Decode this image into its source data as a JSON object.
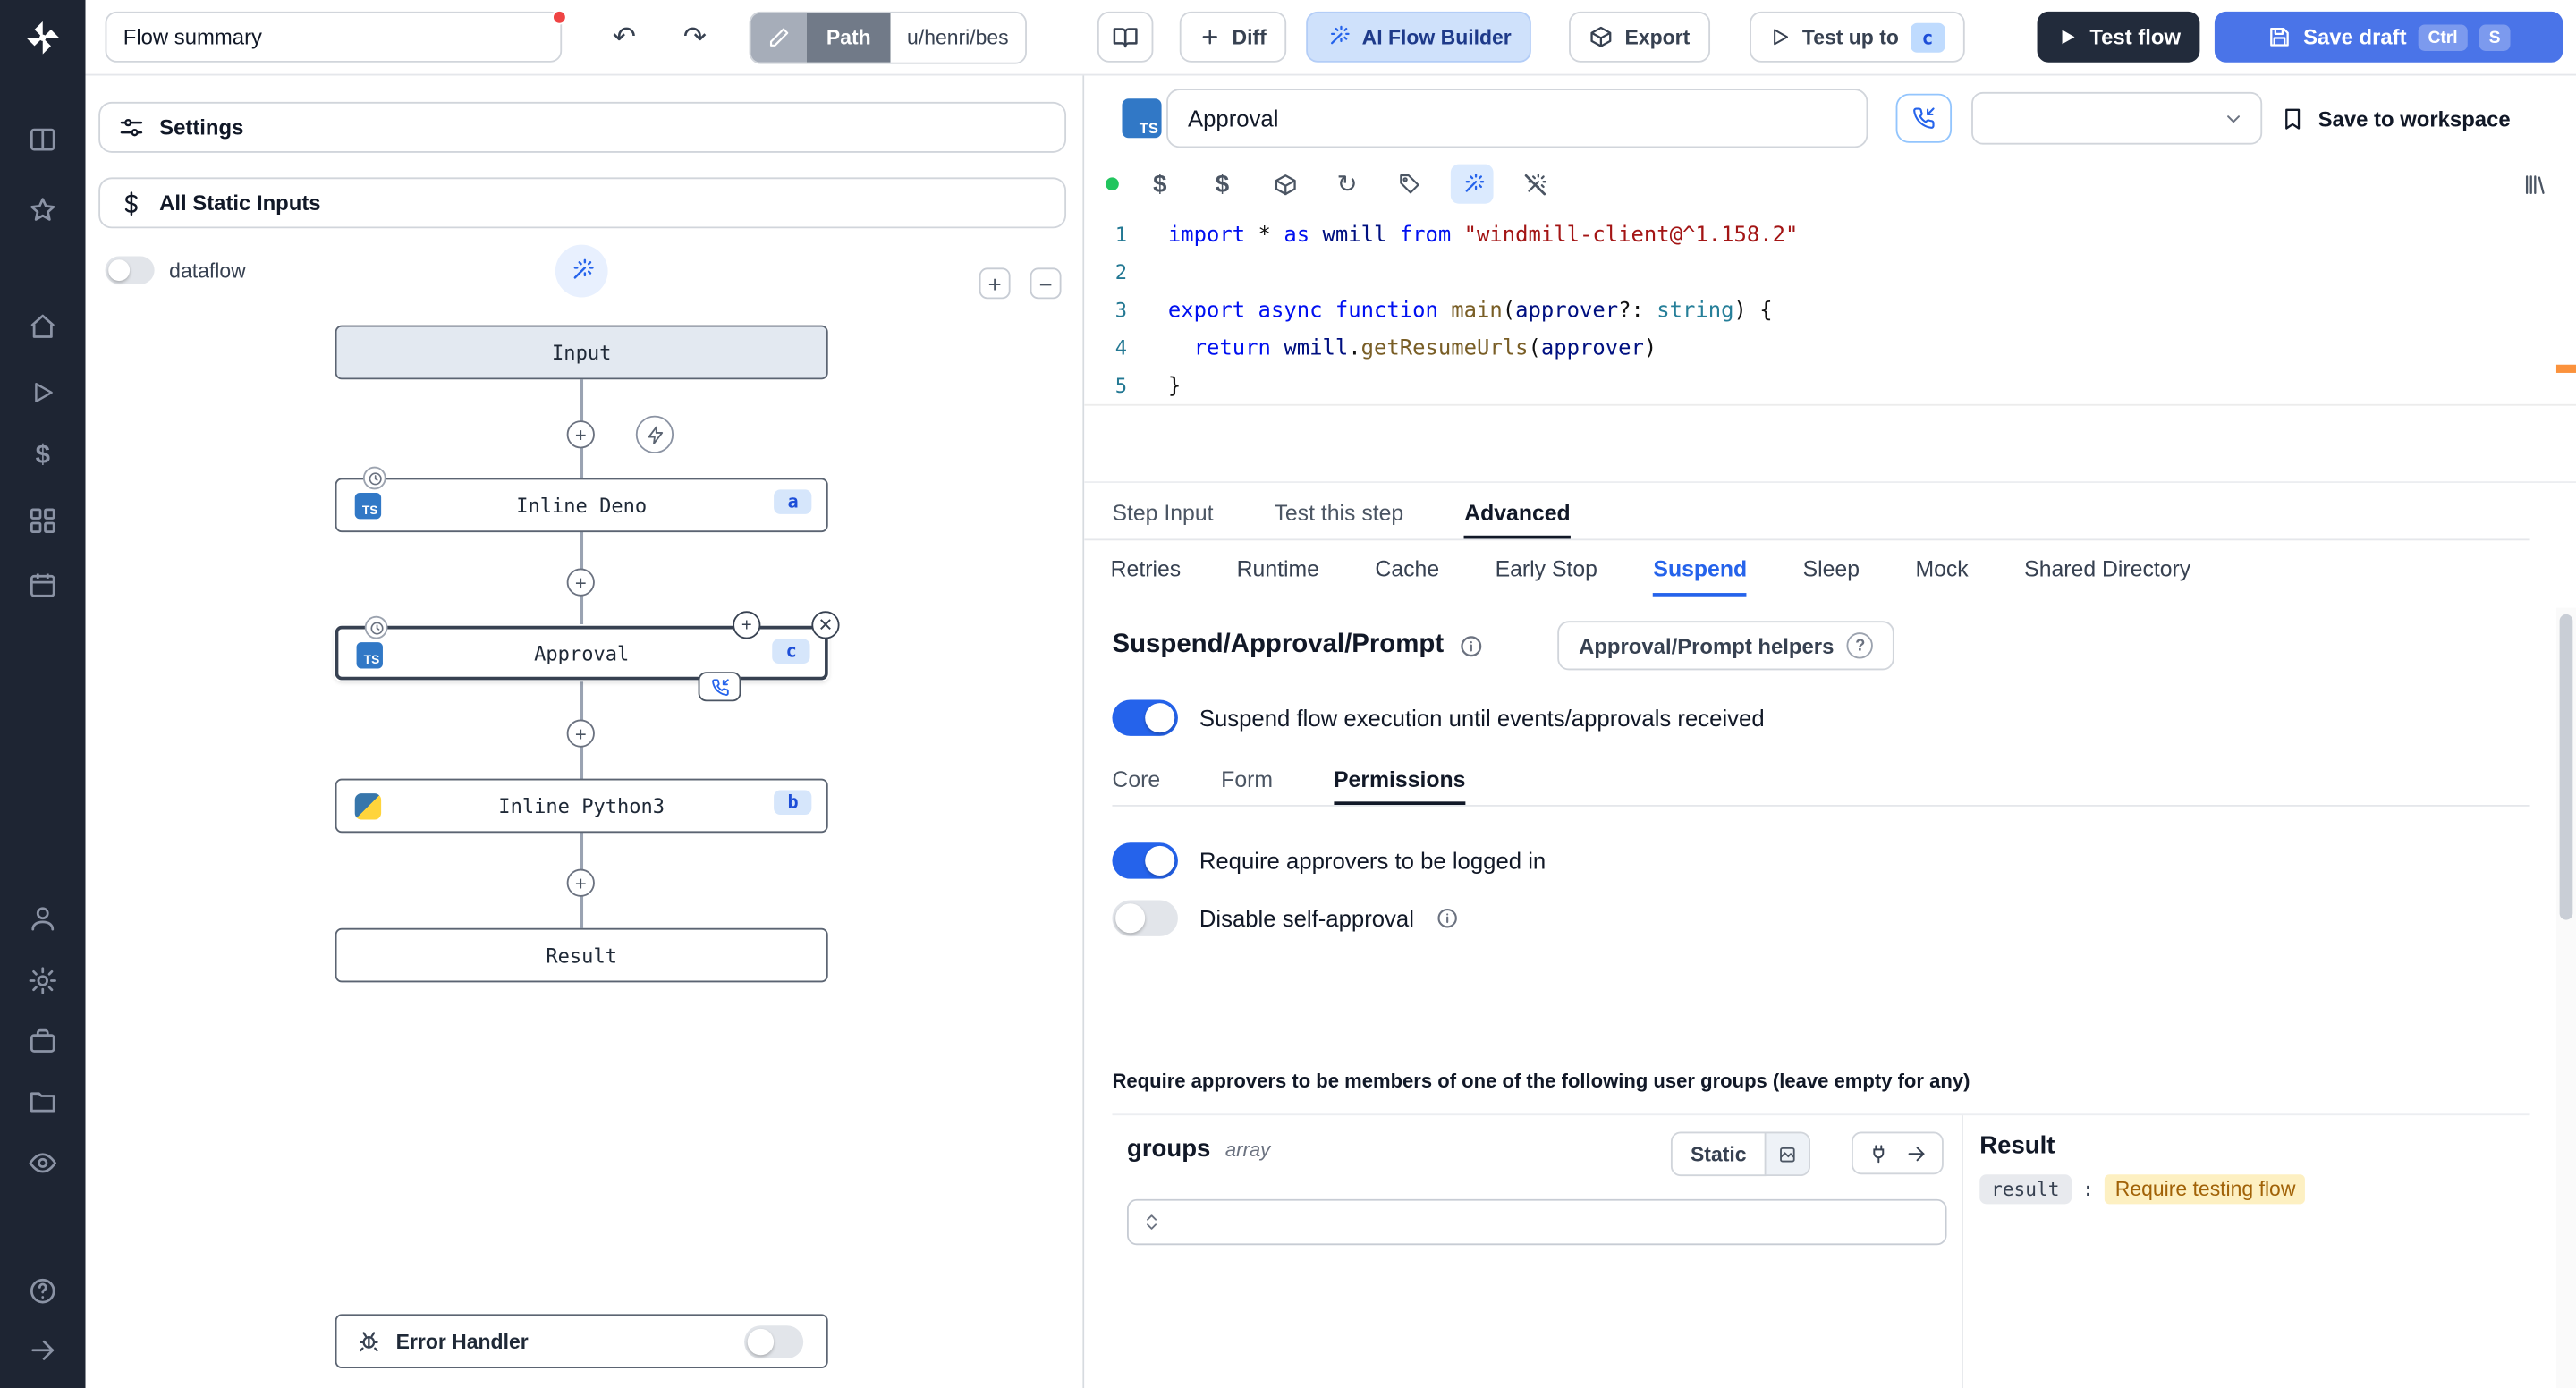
{
  "topbar": {
    "flow_summary_value": "Flow summary",
    "path_label": "Path",
    "path_value": "u/henri/bes",
    "diff_label": "Diff",
    "ai_builder_label": "AI Flow Builder",
    "export_label": "Export",
    "test_up_to_label": "Test up to",
    "test_up_to_badge": "c",
    "test_flow_label": "Test flow",
    "save_draft_label": "Save draft",
    "save_kbd_ctrl": "Ctrl",
    "save_kbd_s": "S"
  },
  "sidebar": {
    "icons": [
      "windmill-logo",
      "panels",
      "star",
      "home",
      "runs-play",
      "variables-dollar",
      "resources-grid",
      "schedules-calendar",
      "users",
      "settings-gear",
      "workers-briefcase",
      "folders",
      "audit-eye",
      "help",
      "collapse-arrow"
    ]
  },
  "flow_panel": {
    "settings_label": "Settings",
    "static_inputs_label": "All Static Inputs",
    "dataflow_label": "dataflow",
    "zoom_plus": "+",
    "zoom_minus": "−",
    "nodes": {
      "input": {
        "label": "Input"
      },
      "deno": {
        "label": "Inline Deno",
        "badge": "a"
      },
      "approval": {
        "label": "Approval",
        "badge": "c"
      },
      "python": {
        "label": "Inline Python3",
        "badge": "b"
      },
      "result": {
        "label": "Result"
      }
    },
    "error_handler_label": "Error Handler"
  },
  "step_header": {
    "name_value": "Approval",
    "save_to_workspace_label": "Save to workspace"
  },
  "editor_toolbar": {
    "icons": [
      "lang-status-dot",
      "variables-dollar",
      "resources-dollar",
      "package",
      "reload",
      "tag",
      "ai-wand-selected",
      "ai-wand-off",
      "library"
    ]
  },
  "editor": {
    "lines": [
      {
        "n": "1",
        "tokens": [
          {
            "c": "kw",
            "t": "import"
          },
          {
            "c": "pl",
            "t": " * "
          },
          {
            "c": "kw",
            "t": "as"
          },
          {
            "c": "var",
            "t": " wmill "
          },
          {
            "c": "kw",
            "t": "from"
          },
          {
            "c": "str",
            "t": " \"windmill-client@^1.158.2\""
          }
        ]
      },
      {
        "n": "2",
        "tokens": []
      },
      {
        "n": "3",
        "tokens": [
          {
            "c": "kw",
            "t": "export"
          },
          {
            "c": "pl",
            "t": " "
          },
          {
            "c": "kw",
            "t": "async"
          },
          {
            "c": "pl",
            "t": " "
          },
          {
            "c": "kw",
            "t": "function"
          },
          {
            "c": "fn",
            "t": " main"
          },
          {
            "c": "pl",
            "t": "("
          },
          {
            "c": "var",
            "t": "approver"
          },
          {
            "c": "pl",
            "t": "?: "
          },
          {
            "c": "type",
            "t": "string"
          },
          {
            "c": "pl",
            "t": ") {"
          }
        ]
      },
      {
        "n": "4",
        "tokens": [
          {
            "c": "pl",
            "t": "  "
          },
          {
            "c": "kw",
            "t": "return"
          },
          {
            "c": "pl",
            "t": " "
          },
          {
            "c": "var",
            "t": "wmill"
          },
          {
            "c": "pl",
            "t": "."
          },
          {
            "c": "fn",
            "t": "getResumeUrls"
          },
          {
            "c": "pl",
            "t": "("
          },
          {
            "c": "var",
            "t": "approver"
          },
          {
            "c": "pl",
            "t": ")"
          }
        ]
      },
      {
        "n": "5",
        "tokens": [
          {
            "c": "pl",
            "t": "}"
          }
        ]
      }
    ]
  },
  "step_tabs": [
    "Step Input",
    "Test this step",
    "Advanced"
  ],
  "advanced_tabs": [
    "Retries",
    "Runtime",
    "Cache",
    "Early Stop",
    "Suspend",
    "Sleep",
    "Mock",
    "Shared Directory"
  ],
  "suspend": {
    "title": "Suspend/Approval/Prompt",
    "helpers_label": "Approval/Prompt helpers",
    "suspend_toggle_label": "Suspend flow execution until events/approvals received",
    "sub_tabs": [
      "Core",
      "Form",
      "Permissions"
    ],
    "require_login_label": "Require approvers to be logged in",
    "disable_self_label": "Disable self-approval",
    "groups_note": "Require approvers to be members of one of the following user groups (leave empty for any)",
    "groups_title": "groups",
    "groups_type": "array",
    "static_label": "Static",
    "result_title": "Result",
    "result_key": "result",
    "result_value": "Require testing flow"
  },
  "colors": {
    "accent_blue": "#2563eb",
    "badge_blue_bg": "#d6e6fb",
    "save_button": "#4a74e8",
    "dark_button": "#222b3b",
    "sidebar_bg": "#1e2533",
    "result_value_bg": "#fdf0c2"
  }
}
